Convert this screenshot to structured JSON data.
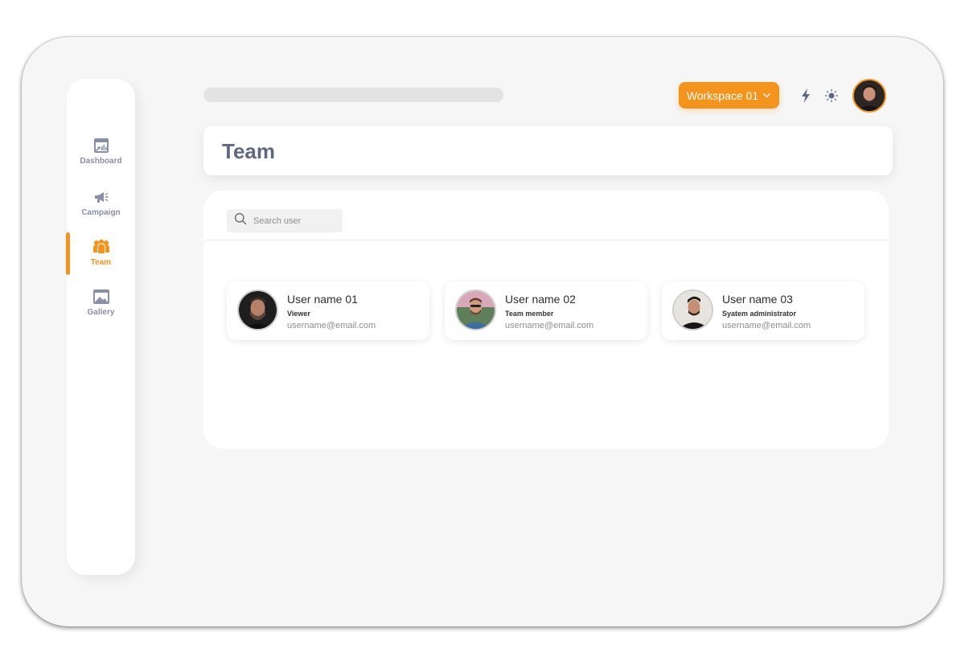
{
  "sidebar": {
    "items": [
      {
        "label": "Dashboard",
        "icon": "dashboard-icon"
      },
      {
        "label": "Campaign",
        "icon": "megaphone-icon"
      },
      {
        "label": "Team",
        "icon": "team-icon",
        "active": true
      },
      {
        "label": "Gallery",
        "icon": "image-icon"
      }
    ]
  },
  "header": {
    "workspace_label": "Workspace 01",
    "icons": [
      "chevron-down-icon",
      "lightning-icon",
      "sun-icon"
    ]
  },
  "page": {
    "title": "Team"
  },
  "search": {
    "placeholder": "Search user"
  },
  "users": [
    {
      "name": "User name 01",
      "role": "Viewer",
      "email": "username@email.com"
    },
    {
      "name": "User name 02",
      "role": "Team member",
      "email": "username@email.com"
    },
    {
      "name": "User name 03",
      "role": "Syatem administrator",
      "email": "username@email.com"
    }
  ],
  "colors": {
    "accent": "#f5941d",
    "title_text": "#5f6783",
    "nav_text": "#8a8fa8",
    "background": "#f6f6f6"
  }
}
